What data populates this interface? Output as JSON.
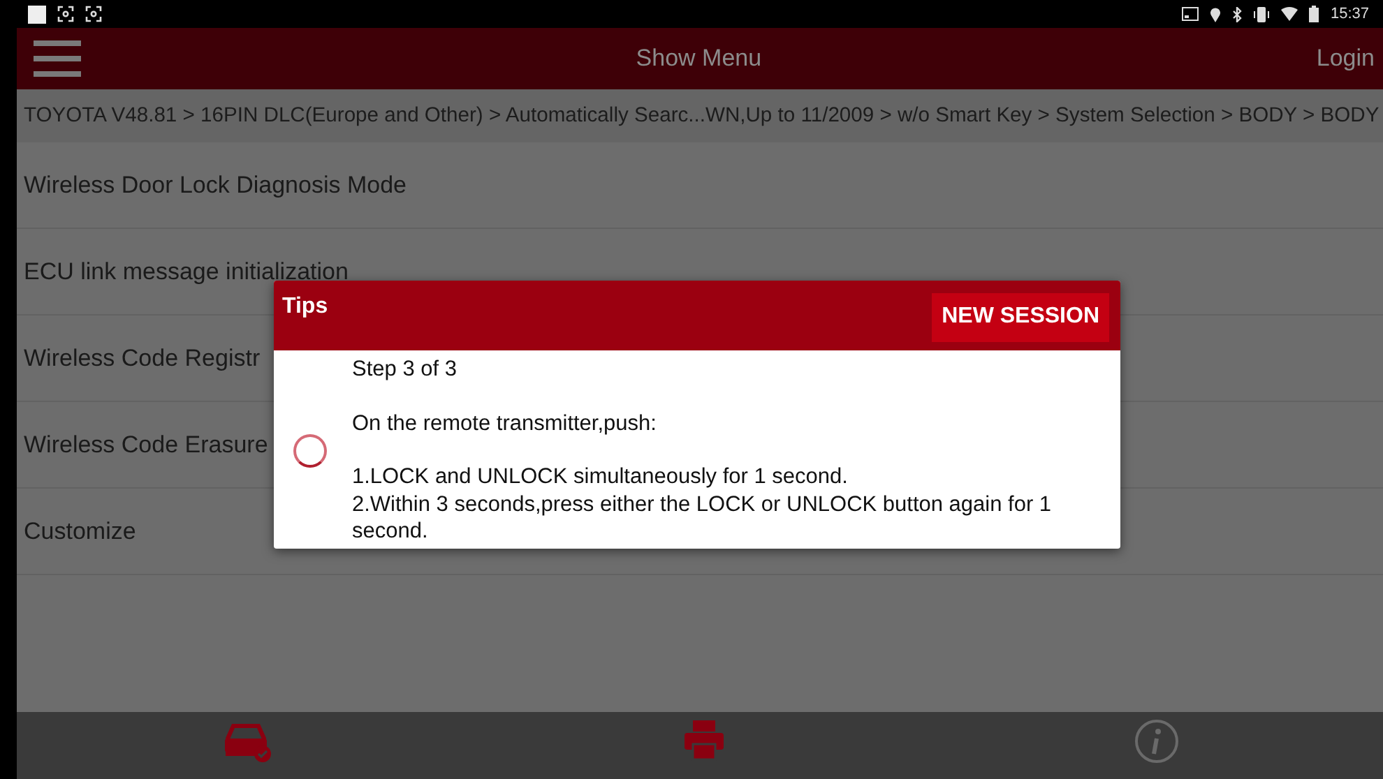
{
  "status_bar": {
    "time": "15:37"
  },
  "header": {
    "title": "Show Menu",
    "login": "Login"
  },
  "breadcrumb": "TOYOTA V48.81 > 16PIN DLC(Europe and Other) > Automatically Searc...WN,Up to 11/2009 > w/o Smart Key > System Selection > BODY > BODY",
  "menu_items": [
    "Wireless Door Lock Diagnosis Mode",
    "ECU link message initialization",
    "Wireless Code Registr",
    "Wireless Code Erasure",
    "Customize"
  ],
  "dialog": {
    "title": "Tips",
    "button": "NEW SESSION",
    "paragraphs": [
      [
        "Step 3 of 3"
      ],
      [
        "On the remote transmitter,push:"
      ],
      [
        "1.LOCK and UNLOCK simultaneously for 1 second.",
        "2.Within 3 seconds,press either the LOCK or UNLOCK button again for 1 second."
      ]
    ]
  }
}
